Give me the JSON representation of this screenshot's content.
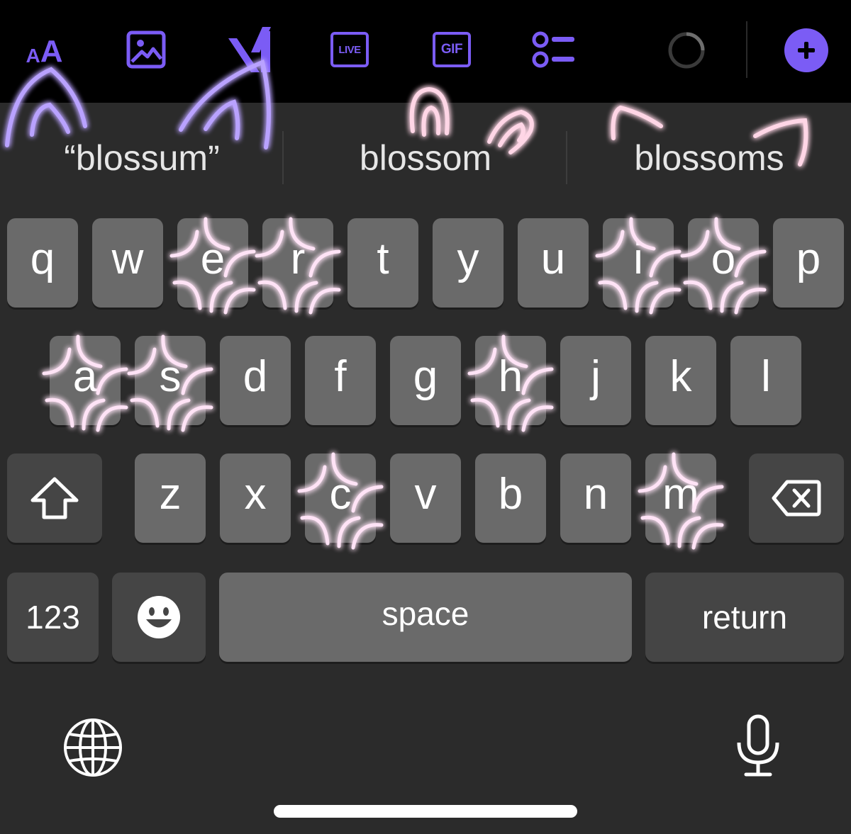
{
  "toolbar": {
    "items": [
      {
        "name": "text-format",
        "icon": "text-size-icon",
        "label": "AA"
      },
      {
        "name": "image",
        "icon": "image-icon"
      },
      {
        "name": "ai",
        "icon": "ai-logo-icon"
      },
      {
        "name": "live",
        "icon": "live-icon",
        "label": "LIVE"
      },
      {
        "name": "gif",
        "icon": "gif-icon",
        "label": "GIF"
      },
      {
        "name": "poll",
        "icon": "list-icon"
      },
      {
        "name": "progress",
        "icon": "progress-ring-icon"
      },
      {
        "name": "add",
        "icon": "plus-icon"
      }
    ],
    "accent_color": "#7b5cf5"
  },
  "suggestions": [
    "“blossum”",
    "blossom",
    "blossoms"
  ],
  "keyboard": {
    "row1": [
      "q",
      "w",
      "e",
      "r",
      "t",
      "y",
      "u",
      "i",
      "o",
      "p"
    ],
    "row2": [
      "a",
      "s",
      "d",
      "f",
      "g",
      "h",
      "j",
      "k",
      "l"
    ],
    "row3": [
      "z",
      "x",
      "c",
      "v",
      "b",
      "n",
      "m"
    ],
    "shift_icon": "shift-icon",
    "delete_icon": "backspace-icon",
    "numbers_label": "123",
    "emoji_icon": "emoji-icon",
    "space_label": "space",
    "return_label": "return",
    "globe_icon": "globe-icon",
    "mic_icon": "microphone-icon"
  },
  "decorations": {
    "cat_ears_color": "#9a78ff",
    "bunny_ears_color": "#ff6fa0",
    "anger_marks_color": "#ff2ec4",
    "anger_mark_keys": [
      "e",
      "r",
      "i",
      "o",
      "a",
      "s",
      "h",
      "c",
      "m"
    ]
  }
}
